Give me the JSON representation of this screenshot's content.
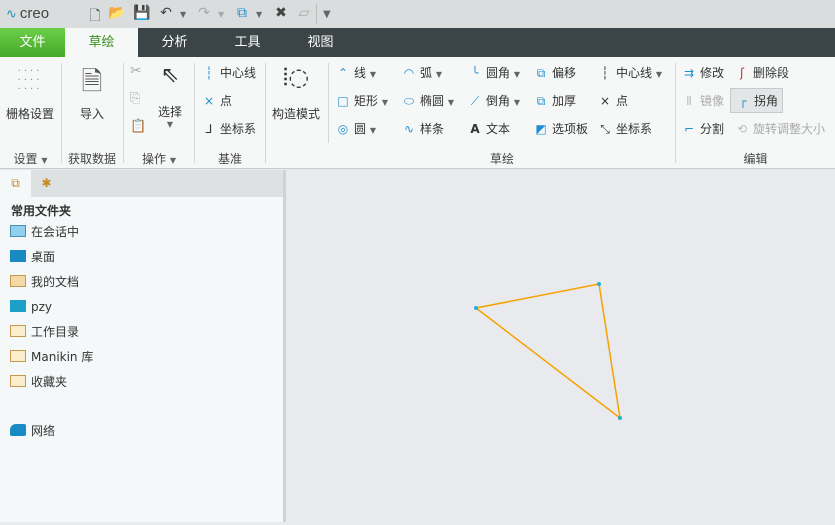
{
  "app": {
    "logo": "creo"
  },
  "quick_access": [
    "new-icon",
    "open-icon",
    "save-icon",
    "undo-icon",
    "redo-icon",
    "window-icon",
    "close-window-icon",
    "regenerate-icon",
    "customize-icon"
  ],
  "tabs": [
    {
      "label": "文件"
    },
    {
      "label": "草绘"
    },
    {
      "label": "分析"
    },
    {
      "label": "工具"
    },
    {
      "label": "视图"
    }
  ],
  "ribbon": {
    "setup": {
      "grid": "栅格设置",
      "group": "设置"
    },
    "get_data": {
      "import": "导入",
      "group": "获取数据"
    },
    "operations": {
      "select": "选择",
      "group": "操作"
    },
    "datum": {
      "centerline": "中心线",
      "point": "点",
      "csys": "坐标系",
      "group": "基准"
    },
    "construction": {
      "label": "构造模式"
    },
    "sketching": {
      "line": "线",
      "arc": "弧",
      "fillet": "圆角",
      "offset": "偏移",
      "rect": "矩形",
      "ellipse": "椭圆",
      "chamfer": "倒角",
      "thicken": "加厚",
      "circle": "圆",
      "spline": "样条",
      "text": "文本",
      "palette": "选项板",
      "centerline": "中心线",
      "point": "点",
      "csys": "坐标系",
      "group": "草绘"
    },
    "editing": {
      "modify": "修改",
      "delete_segment": "删除段",
      "mirror": "镜像",
      "corner": "拐角",
      "divide": "分割",
      "rotate_resize": "旋转调整大小",
      "group": "编辑"
    }
  },
  "folders": {
    "title": "常用文件夹",
    "items": [
      {
        "label": "在会话中"
      },
      {
        "label": "桌面"
      },
      {
        "label": "我的文档"
      },
      {
        "label": "pzy"
      },
      {
        "label": "工作目录"
      },
      {
        "label": "Manikin 库"
      },
      {
        "label": "收藏夹"
      },
      {
        "label": "网络"
      }
    ]
  },
  "colors": {
    "sketch": "#f5a300",
    "vertex": "#1fb2d6",
    "accent": "#1e8fd0"
  }
}
